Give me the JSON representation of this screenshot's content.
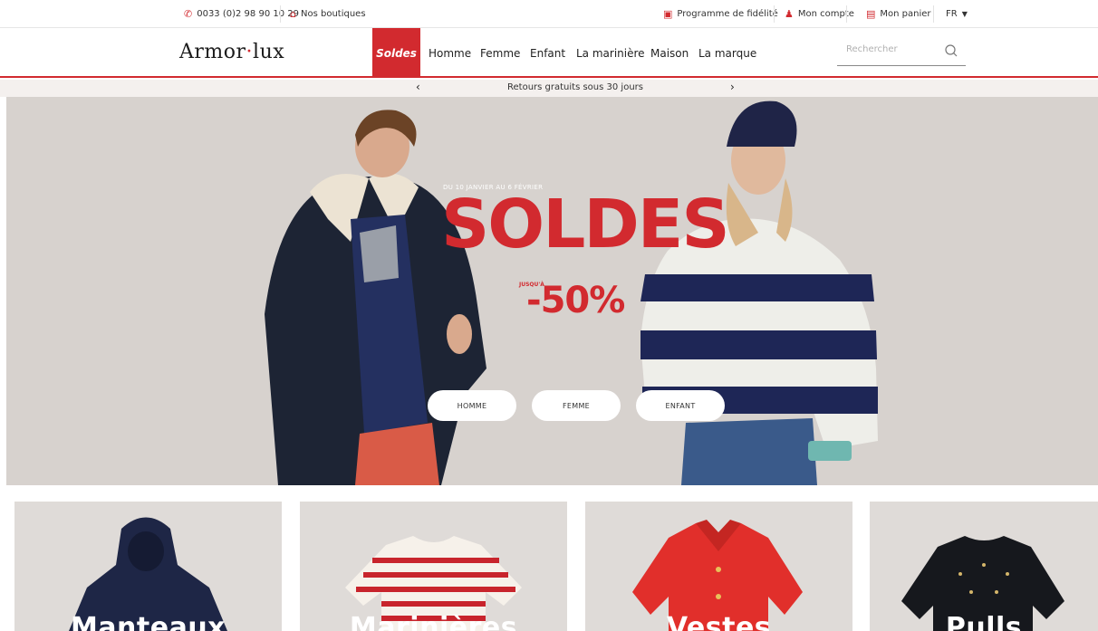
{
  "topbar": {
    "phone": "0033 (0)2 98 90 10 29",
    "shops": "Nos boutiques",
    "loyalty": "Programme de fidélité",
    "account": "Mon compte",
    "cart": "Mon panier",
    "language": "FR"
  },
  "brand": {
    "name_a": "Armor",
    "dot": "·",
    "name_b": "lux"
  },
  "nav": {
    "items": [
      "Soldes",
      "Homme",
      "Femme",
      "Enfant",
      "La marinière",
      "Maison",
      "La marque"
    ]
  },
  "search": {
    "placeholder": "Rechercher"
  },
  "promo": {
    "message": "Retours gratuits sous 30 jours"
  },
  "hero": {
    "dates": "DU 10 JANVIER AU 6 FÉVRIER",
    "title": "SOLDES",
    "upto": "JUSQU'À",
    "discount": "-50%",
    "buttons": [
      "HOMME",
      "FEMME",
      "ENFANT"
    ]
  },
  "categories": [
    "Manteaux",
    "Marinières",
    "Vestes",
    "Pulls"
  ],
  "colors": {
    "accent": "#d22a2f",
    "hero_bg": "#d7d2ce",
    "tile_bg": "#dfdbd8"
  }
}
